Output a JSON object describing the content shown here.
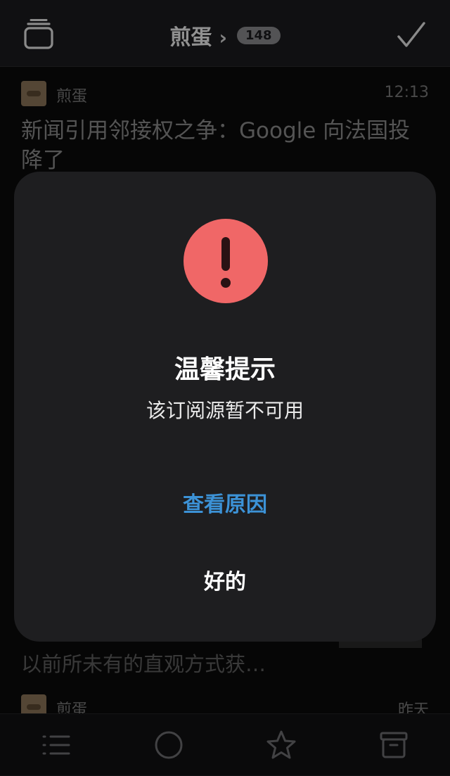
{
  "header": {
    "title": "煎蛋",
    "chevron": "›",
    "unread_count": "148",
    "left_icon": "stack-icon",
    "right_icon": "checkmark-icon"
  },
  "list": {
    "items": [
      {
        "source": "煎蛋",
        "time": "12:13",
        "headline": "新闻引用邻接权之争：Google 向法国投降了"
      },
      {
        "source": "煎蛋",
        "time": "昨天"
      }
    ],
    "excerpt": "以前所未有的直观方式获…"
  },
  "dialog": {
    "icon": "exclamation-circle-icon",
    "title": "温馨提示",
    "message": "该订阅源暂不可用",
    "primary_action": "查看原因",
    "dismiss_action": "好的"
  },
  "tabbar": {
    "tabs": [
      {
        "icon": "list-icon"
      },
      {
        "icon": "circle-icon"
      },
      {
        "icon": "star-icon"
      },
      {
        "icon": "archive-icon"
      }
    ]
  },
  "colors": {
    "alert_red": "#f06767",
    "link_blue": "#3c92d6",
    "modal_bg": "#1e1e20"
  }
}
